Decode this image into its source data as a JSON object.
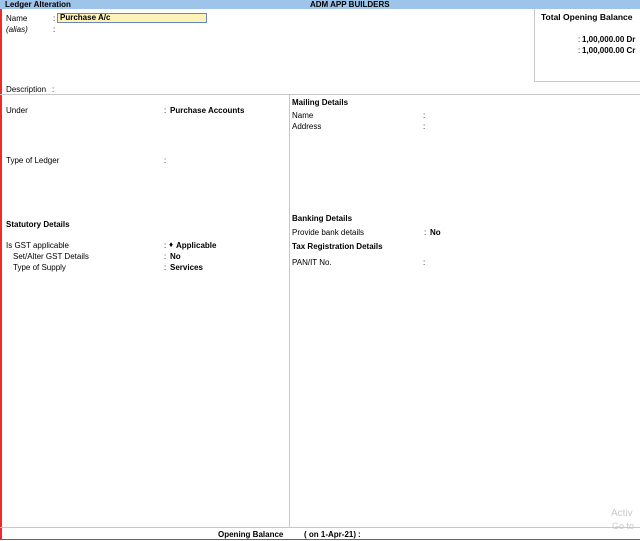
{
  "titlebar": {
    "screen_title": "Ledger Alteration",
    "company": "ADM  APP BUILDERS"
  },
  "ledger": {
    "name_label": "Name",
    "name_colon": ":",
    "name_value": "Purchase A/c",
    "alias_label": "(alias)",
    "alias_colon": ":"
  },
  "opening_panel": {
    "title": "Total Opening Balance",
    "rows": [
      {
        "colon": ":",
        "value": "1,00,000.00 Dr"
      },
      {
        "colon": ":",
        "value": "1,00,000.00 Cr"
      }
    ]
  },
  "description": {
    "label": "Description",
    "colon": ":"
  },
  "left": {
    "under_label": "Under",
    "under_colon": ":",
    "under_value": "Purchase Accounts",
    "type_label": "Type of Ledger",
    "type_colon": ":",
    "statutory_title": "Statutory Details",
    "gst_label": "Is GST applicable",
    "gst_colon": ":",
    "gst_bullet": "♦",
    "gst_value": "Applicable",
    "setalter_label": "Set/Alter GST Details",
    "setalter_colon": ":",
    "setalter_value": "No",
    "supply_label": "Type of Supply",
    "supply_colon": ":",
    "supply_value": "Services"
  },
  "right": {
    "mailing_title": "Mailing Details",
    "mail_name_label": "Name",
    "mail_name_colon": ":",
    "address_label": "Address",
    "address_colon": ":",
    "banking_title": "Banking Details",
    "bank_label": "Provide bank details",
    "bank_colon": ":",
    "bank_value": "No",
    "tax_title": "Tax Registration Details",
    "pan_label": "PAN/IT No.",
    "pan_colon": ":"
  },
  "footer": {
    "label": "Opening Balance",
    "date": "( on 1-Apr-21)",
    "colon": ":"
  },
  "watermark": {
    "line1": "Activ",
    "line2": "Go to"
  }
}
